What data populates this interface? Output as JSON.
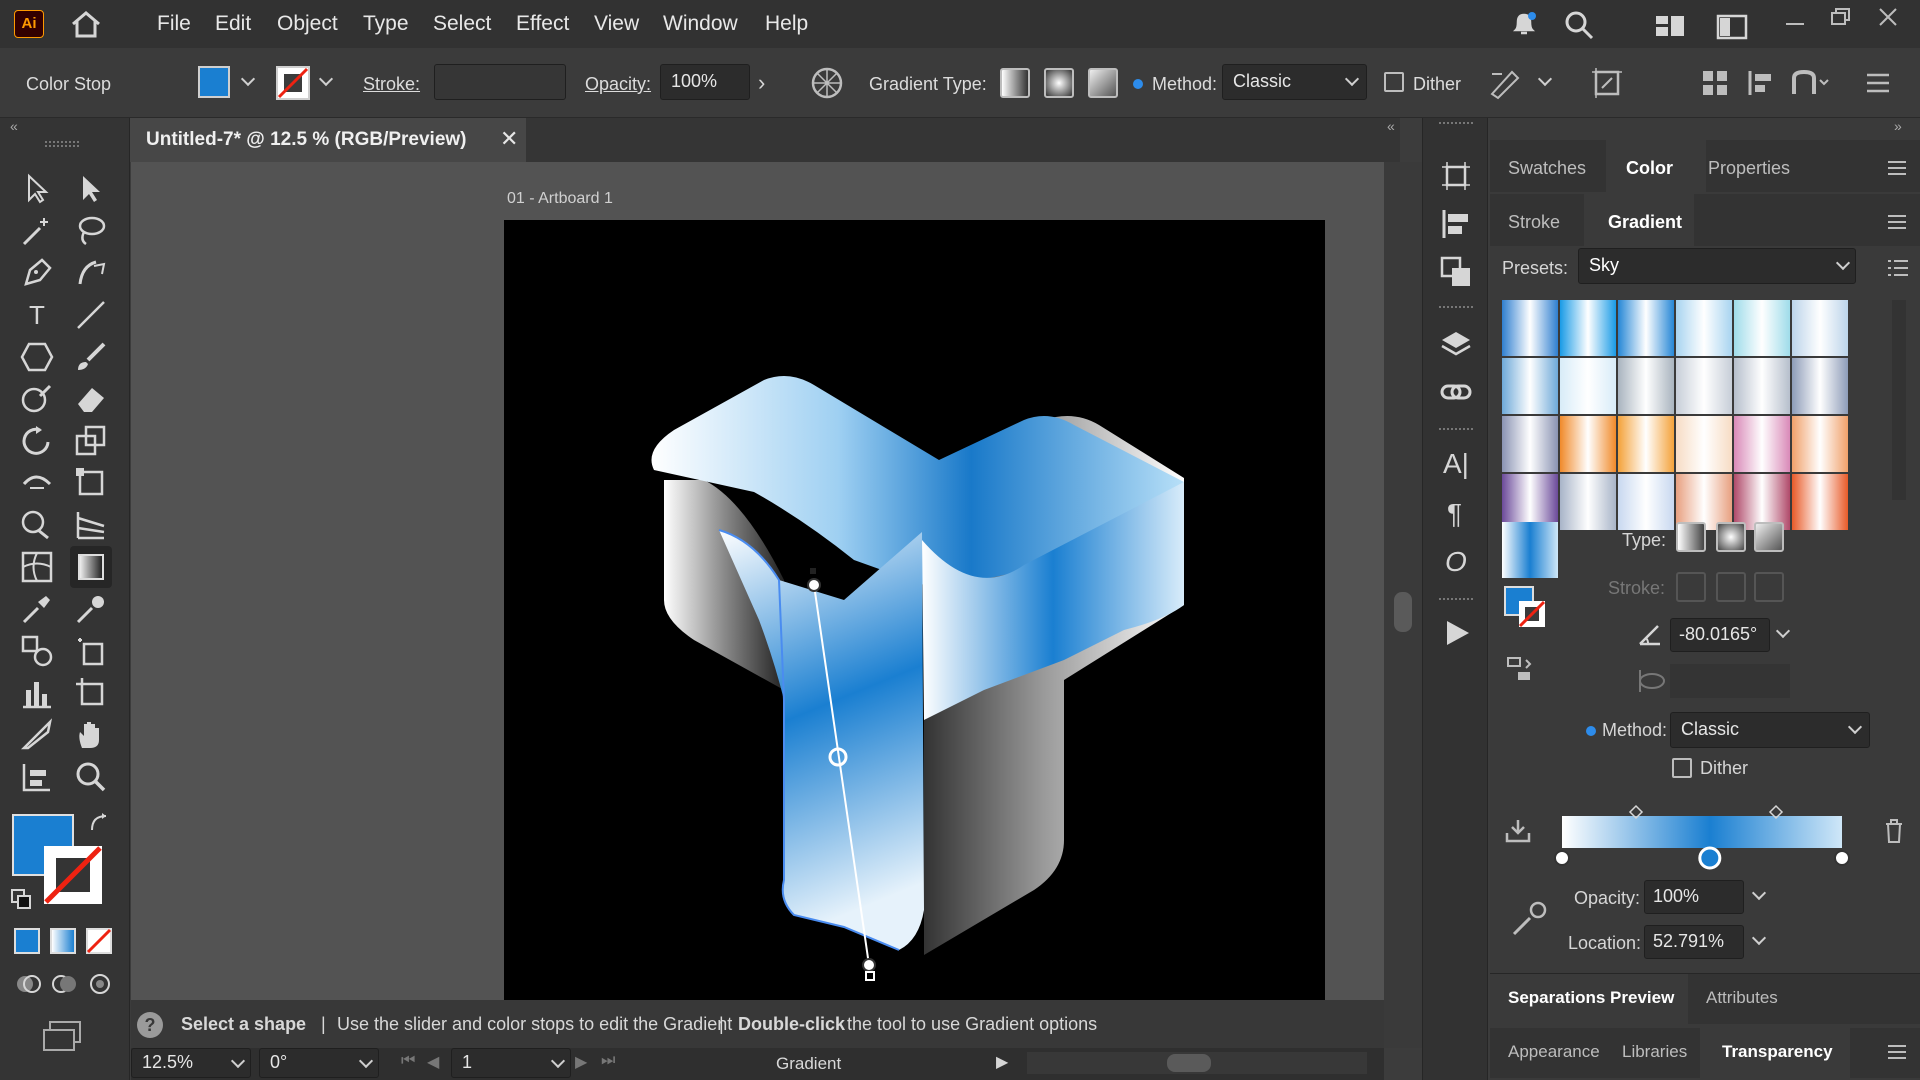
{
  "app": {
    "logo_text": "Ai"
  },
  "menu": [
    "File",
    "Edit",
    "Object",
    "Type",
    "Select",
    "Effect",
    "View",
    "Window",
    "Help"
  ],
  "control_bar": {
    "context_label": "Color Stop",
    "stroke_label": "Stroke:",
    "opacity_label": "Opacity:",
    "opacity_value": "100%",
    "gradient_type_label": "Gradient Type:",
    "method_label": "Method:",
    "method_value": "Classic",
    "dither_label": "Dither",
    "fill_color": "#1a7fd1"
  },
  "document": {
    "tab_title": "Untitled-7* @ 12.5 % (RGB/Preview)",
    "artboard_label": "01 - Artboard 1"
  },
  "panel_tabs": {
    "top": [
      "Swatches",
      "Color",
      "Properties"
    ],
    "top_active": "Color",
    "second": [
      "Stroke",
      "Gradient"
    ],
    "second_active": "Gradient"
  },
  "gradient_panel": {
    "presets_label": "Presets:",
    "presets_value": "Sky",
    "type_label": "Type:",
    "stroke_label": "Stroke:",
    "angle_value": "-80.0165°",
    "method_label": "Method:",
    "method_value": "Classic",
    "dither_label": "Dither",
    "opacity_label": "Opacity:",
    "opacity_value": "100%",
    "location_label": "Location:",
    "location_value": "52.791%",
    "stop_locations": [
      0,
      0.52791,
      1
    ],
    "swatches": [
      [
        "#2f7fd0",
        "#1a9be6",
        "#2687d6",
        "#a8d4f0",
        "#9fdcea",
        "#bcd4ea"
      ],
      [
        "#6ea9d8",
        "#d8ecf8",
        "#a9b4bf",
        "#c7ced8",
        "#b6bfcc",
        "#8d9cb8"
      ],
      [
        "#8a93b3",
        "#f08a2a",
        "#f4a23a",
        "#f7dcc4",
        "#d98ab8",
        "#f0a06a"
      ],
      [
        "#6b4a9a",
        "#a8b4c8",
        "#c8d8f0",
        "#e8a080",
        "#b04a6a",
        "#e85a28"
      ]
    ]
  },
  "bottom_panels": {
    "row1": [
      "Separations Preview",
      "Attributes"
    ],
    "row2": [
      "Appearance",
      "Libraries",
      "Transparency"
    ]
  },
  "status": {
    "select_shape": "Select a shape",
    "sep1": "|",
    "hint": "Use the slider and color stops to edit the Gradient",
    "sep2": "|",
    "dbl_bold": "Double-click",
    "dbl_rest": "the tool to use Gradient options"
  },
  "bottom_bar": {
    "zoom": "12.5%",
    "rotation": "0°",
    "artboard_num": "1",
    "tool_name": "Gradient"
  }
}
